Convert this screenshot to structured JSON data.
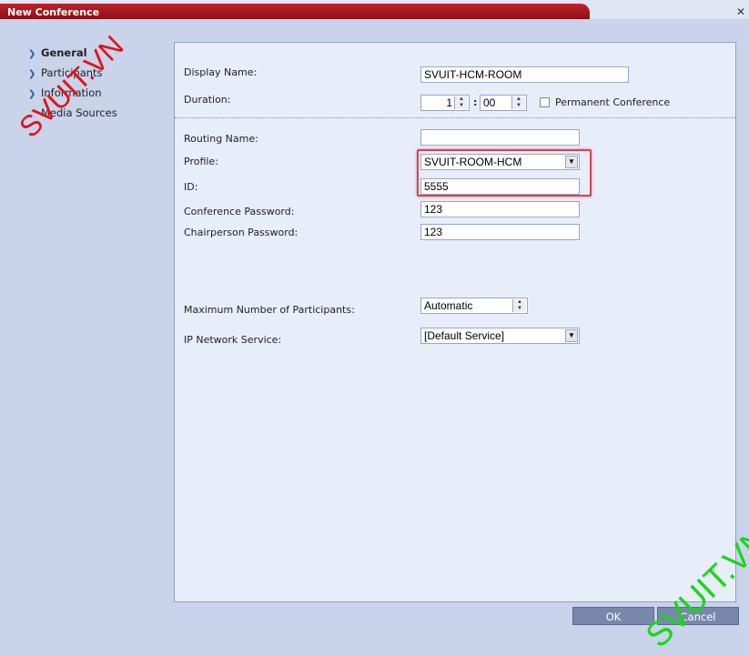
{
  "window": {
    "title": "New Conference",
    "close_glyph": "✕"
  },
  "nav": {
    "items": [
      {
        "label": "General",
        "selected": true,
        "chevron": true
      },
      {
        "label": "Participants",
        "selected": false,
        "chevron": true
      },
      {
        "label": "Information",
        "selected": false,
        "chevron": true
      },
      {
        "label": "Media Sources",
        "selected": false,
        "chevron": false
      }
    ]
  },
  "form": {
    "display_name_label": "Display Name:",
    "display_name_value": "SVUIT-HCM-ROOM",
    "duration_label": "Duration:",
    "duration_hours": "1",
    "duration_separator": ":",
    "duration_minutes": "00",
    "permanent_label": "Permanent Conference",
    "permanent_checked": false,
    "routing_name_label": "Routing Name:",
    "routing_name_value": "",
    "profile_label": "Profile:",
    "profile_value": "SVUIT-ROOM-HCM",
    "id_label": "ID:",
    "id_value": "5555",
    "conf_password_label": "Conference Password:",
    "conf_password_value": "123",
    "chair_password_label": "Chairperson Password:",
    "chair_password_value": "123",
    "max_participants_label": "Maximum Number of Participants:",
    "max_participants_value": "Automatic",
    "ip_service_label": "IP Network Service:",
    "ip_service_value": "[Default Service]"
  },
  "buttons": {
    "ok": "OK",
    "cancel": "Cancel"
  },
  "watermarks": {
    "top": "SVUIT.VN",
    "bottom": "SVUIT.VN"
  },
  "colors": {
    "title_red": "#b81c25",
    "highlight_red": "#d9434d",
    "watermark_red": "#e3101b",
    "watermark_green": "#1ad61a"
  }
}
